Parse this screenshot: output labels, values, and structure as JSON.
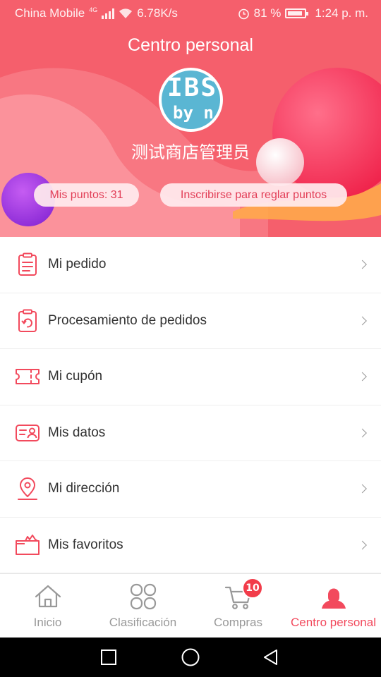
{
  "status_bar": {
    "carrier": "China Mobile",
    "network": "4G",
    "speed": "6.78K/s",
    "battery": "81 %",
    "time": "1:24 p. m."
  },
  "header": {
    "title": "Centro personal",
    "username": "测试商店管理员",
    "avatar_text_line1": "IBS",
    "avatar_text_line2": "by n",
    "points_label": "Mis puntos: 31",
    "signin_label": "Inscribirse para reglar puntos"
  },
  "menu": {
    "items": [
      {
        "label": "Mi pedido",
        "icon": "order-list-icon"
      },
      {
        "label": "Procesamiento de pedidos",
        "icon": "order-processing-icon"
      },
      {
        "label": "Mi cupón",
        "icon": "coupon-icon"
      },
      {
        "label": "Mis datos",
        "icon": "profile-data-icon"
      },
      {
        "label": "Mi dirección",
        "icon": "location-pin-icon"
      },
      {
        "label": "Mis favoritos",
        "icon": "favorites-box-icon"
      }
    ]
  },
  "tabbar": {
    "tabs": [
      {
        "label": "Inicio",
        "icon": "home-icon"
      },
      {
        "label": "Clasificación",
        "icon": "category-icon"
      },
      {
        "label": "Compras",
        "icon": "cart-icon",
        "badge": "10"
      },
      {
        "label": "Centro personal",
        "icon": "user-icon",
        "active": true
      }
    ]
  },
  "colors": {
    "accent": "#f24a5d",
    "header_bg": "#f55f6c",
    "badge": "#f23c4a"
  }
}
